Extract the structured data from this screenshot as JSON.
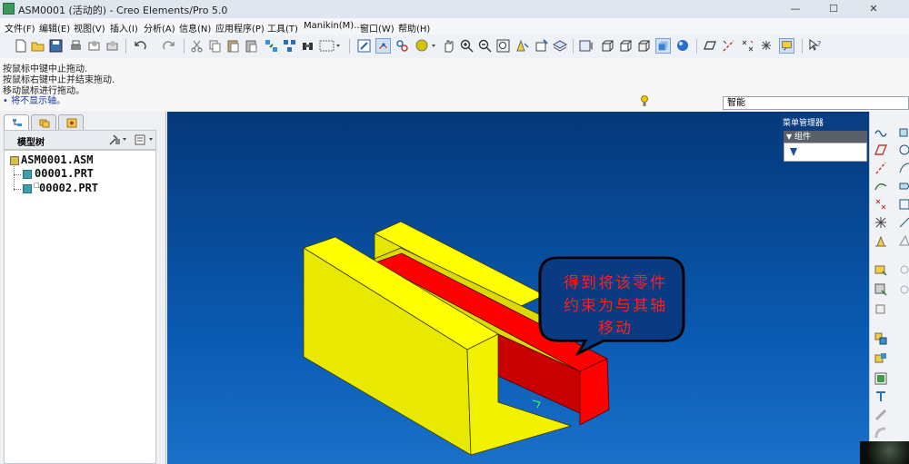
{
  "window": {
    "title": "ASM0001 (活动的) - Creo Elements/Pro 5.0",
    "minimize": "—",
    "maximize": "☐",
    "close": "✕"
  },
  "menubar": [
    {
      "label": "文件(F)"
    },
    {
      "label": "编辑(E)"
    },
    {
      "label": "视图(V)"
    },
    {
      "label": "插入(I)"
    },
    {
      "label": "分析(A)"
    },
    {
      "label": "信息(N)"
    },
    {
      "label": "应用程序(P)"
    },
    {
      "label": "工具(T)"
    },
    {
      "label": "Manikin(M)..."
    },
    {
      "label": "窗口(W)"
    },
    {
      "label": "帮助(H)"
    }
  ],
  "messages": [
    "按鼠标中键中止拖动.",
    "按鼠标右键中止并结束拖动.",
    "移动鼠标进行拖动。",
    "• 将不显示轴。"
  ],
  "filter": {
    "value": "智能"
  },
  "left_panel": {
    "header": "模型树",
    "tree": [
      {
        "label": "ASM0001.ASM"
      },
      {
        "label": "00001.PRT"
      },
      {
        "label": "00002.PRT"
      }
    ]
  },
  "menu_manager": {
    "title": "菜单管理器",
    "heading": "组件"
  },
  "callout": {
    "lines": [
      "得到将该零件",
      "约束为与其轴",
      "移动"
    ]
  },
  "colors": {
    "part_yellow": "#ffff00",
    "part_red": "#ff0000",
    "viewport_top": "#05387a",
    "viewport_bottom": "#1b70c9",
    "callout_text": "#ff1f1f"
  }
}
